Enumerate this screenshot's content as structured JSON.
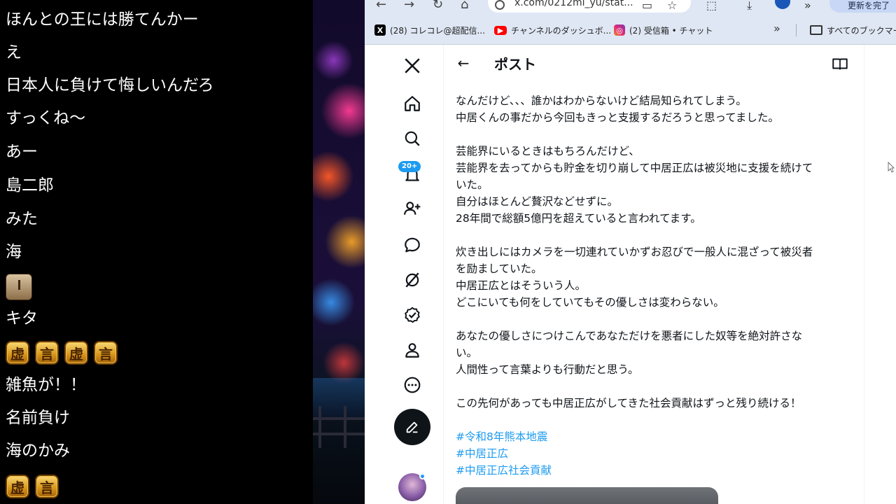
{
  "chat": {
    "lines": [
      "ほんとの王には勝てんかー",
      "え",
      "日本人に負けて悔しいんだろ",
      "すっくね〜",
      "あー",
      "島二郎",
      "みた",
      "海",
      "キタ",
      "雑魚が！！",
      "名前負け",
      "海のかみ"
    ],
    "stamp_row_1": [
      "虚",
      "言",
      "虚",
      "言"
    ],
    "stamp_row_2": [
      "虚",
      "言"
    ]
  },
  "browser": {
    "url": "x.com/0212mi_yu/stat...",
    "update_button": "更新を完了",
    "bookmarks": [
      {
        "label": "(28) コレコレ@超配信..."
      },
      {
        "label": "チャンネルのダッシュボ..."
      },
      {
        "label": "(2) 受信箱 • チャット"
      }
    ],
    "bookmarks_more": "»",
    "all_bookmarks": "すべてのブックマーク"
  },
  "x": {
    "page_title": "ポスト",
    "notification_badge": "20+",
    "post_lines": [
      "なんだけど、、、誰かはわからないけど結局知られてしまう。",
      "中居くんの事だから今回もきっと支援するだろうと思ってました。",
      "",
      "芸能界にいるときはもちろんだけど、",
      "芸能界を去ってからも貯金を切り崩して中居正広は被災地に支援を続けて",
      "いた。",
      "自分はほとんど贅沢などせずに。",
      "28年間で総額5億円を超えていると言われてます。",
      "",
      "炊き出しにはカメラを一切連れていかずお忍びで一般人に混ざって被災者",
      "を励ましていた。",
      "中居正広とはそういう人。",
      "どこにいても何をしていてもその優しさは変わらない。",
      "",
      "あなたの優しさにつけこんであなただけを悪者にした奴等を絶対許さな",
      "い。",
      "人間性って言葉よりも行動だと思う。",
      "",
      "この先何があっても中居正広がしてきた社会貢献はずっと残り続ける！",
      ""
    ],
    "hashtags": [
      "#令和8年熊本地震",
      "#中居正広",
      "#中居正広社会貢献"
    ]
  }
}
